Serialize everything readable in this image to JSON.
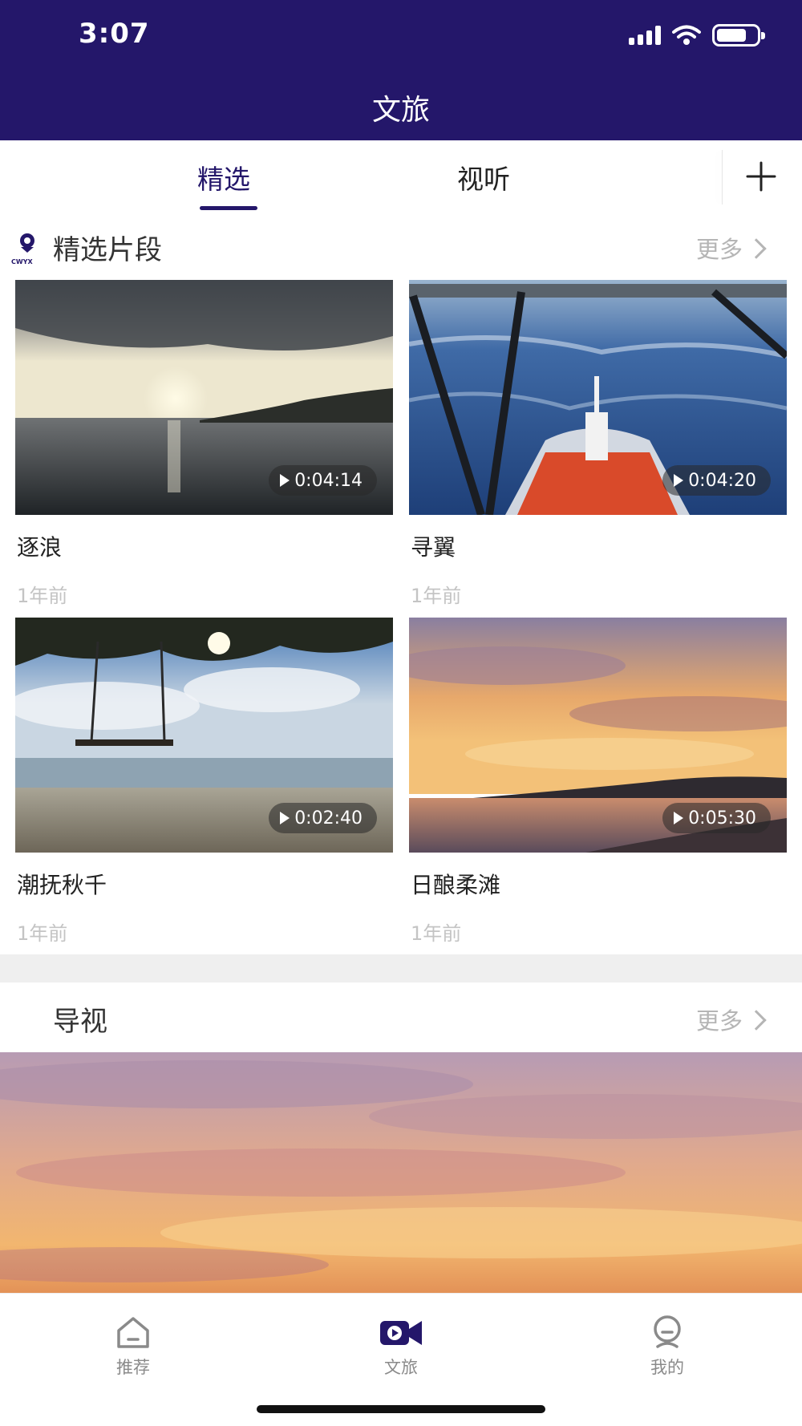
{
  "status_bar": {
    "time": "3:07"
  },
  "header": {
    "title": "文旅"
  },
  "tabs": [
    {
      "label": "精选",
      "active": true
    },
    {
      "label": "视听",
      "active": false
    }
  ],
  "featured": {
    "title": "精选片段",
    "logo_text": "CWYX",
    "more_label": "更多",
    "items": [
      {
        "title": "逐浪",
        "duration": "0:04:14",
        "age": "1年前"
      },
      {
        "title": "寻翼",
        "duration": "0:04:20",
        "age": "1年前"
      },
      {
        "title": "潮抚秋千",
        "duration": "0:02:40",
        "age": "1年前"
      },
      {
        "title": "日酿柔滩",
        "duration": "0:05:30",
        "age": "1年前"
      }
    ]
  },
  "guide": {
    "title": "导视",
    "more_label": "更多"
  },
  "bottom_nav": [
    {
      "label": "推荐",
      "icon": "home-icon",
      "active": false
    },
    {
      "label": "文旅",
      "icon": "video-camera-icon",
      "active": true
    },
    {
      "label": "我的",
      "icon": "user-icon",
      "active": false
    }
  ],
  "colors": {
    "brand": "#24176a",
    "muted_text": "#b5b5b5",
    "divider": "#efefef"
  }
}
